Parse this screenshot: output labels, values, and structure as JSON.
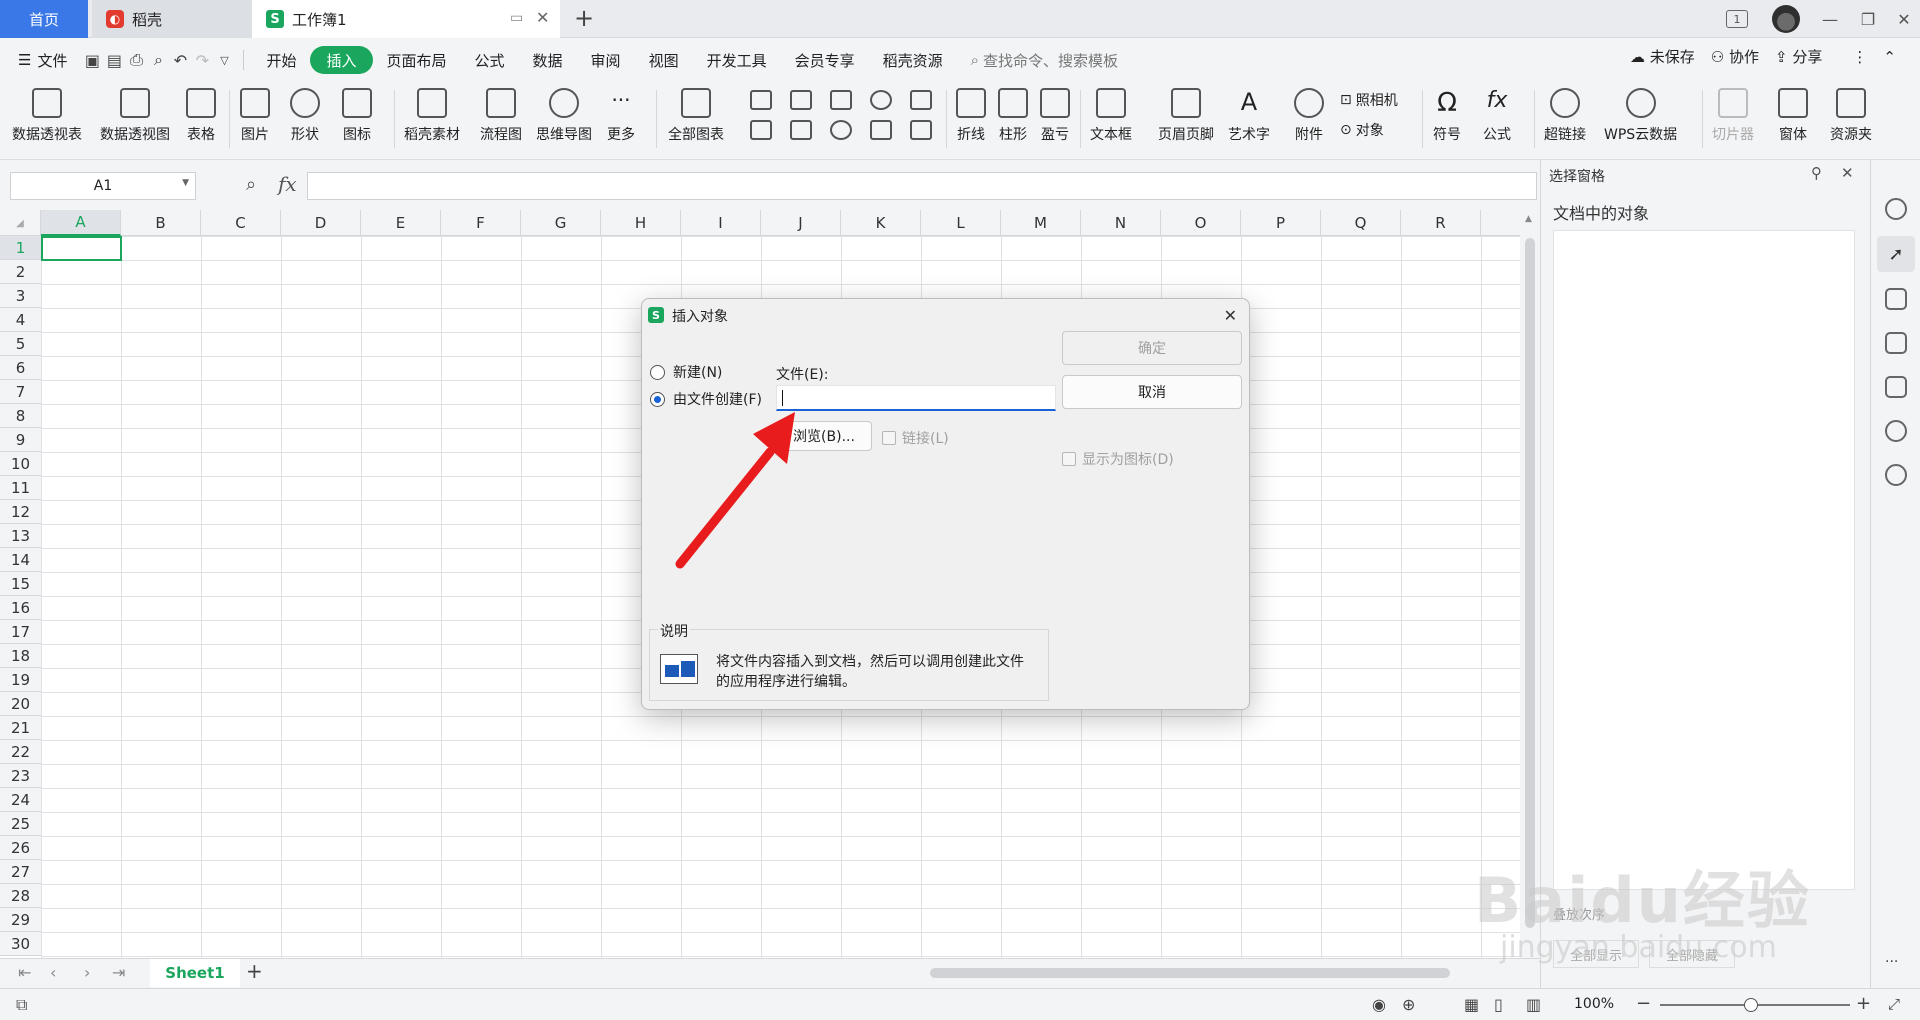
{
  "tabs": {
    "home": "首页",
    "daoke": "稻壳",
    "workbook": "工作簿1",
    "new_tab": "+"
  },
  "window": {
    "badge": "1"
  },
  "menubar": {
    "file": "文件",
    "items": [
      "开始",
      "插入",
      "页面布局",
      "公式",
      "数据",
      "审阅",
      "视图",
      "开发工具",
      "会员专享",
      "稻壳资源"
    ],
    "active": "插入",
    "search": "查找命令、搜索模板",
    "unsaved": "未保存",
    "collab": "协作",
    "share": "分享"
  },
  "ribbon": {
    "pivot_table": "数据透视表",
    "pivot_view": "数据透视图",
    "table": "表格",
    "picture": "图片",
    "shape": "形状",
    "icon": "图标",
    "daoke_material": "稻壳素材",
    "flowchart": "流程图",
    "mindmap": "思维导图",
    "more": "更多",
    "all_charts": "全部图表",
    "line": "折线",
    "column": "柱形",
    "winloss": "盈亏",
    "textbox": "文本框",
    "header_footer": "页眉页脚",
    "wordart": "艺术字",
    "attachment": "附件",
    "camera": "照相机",
    "object": "对象",
    "symbol": "符号",
    "formula": "公式",
    "hyperlink": "超链接",
    "wps_cloud": "WPS云数据",
    "slicer": "切片器",
    "form": "窗体",
    "resources": "资源夹"
  },
  "formula_bar": {
    "cell_ref": "A1",
    "fx": "fx"
  },
  "columns": [
    "A",
    "B",
    "C",
    "D",
    "E",
    "F",
    "G",
    "H",
    "I",
    "J",
    "K",
    "L",
    "M",
    "N",
    "O",
    "P",
    "Q",
    "R"
  ],
  "rows": [
    "1",
    "2",
    "3",
    "4",
    "5",
    "6",
    "7",
    "8",
    "9",
    "10",
    "11",
    "12",
    "13",
    "14",
    "15",
    "16",
    "17",
    "18",
    "19",
    "20",
    "21",
    "22",
    "23",
    "24",
    "25",
    "26",
    "27",
    "28",
    "29",
    "30"
  ],
  "sheets": {
    "active": "Sheet1",
    "add": "+"
  },
  "status": {
    "zoom": "100%"
  },
  "pane": {
    "title": "选择窗格",
    "subtitle": "文档中的对象",
    "btn_show_all": "全部显示",
    "btn_hide_all": "全部隐藏",
    "order_label": "叠放次序"
  },
  "dialog": {
    "title": "插入对象",
    "close": "✕",
    "radio_new": "新建(N)",
    "radio_from_file": "由文件创建(F)",
    "file_label": "文件(E):",
    "file_value": "",
    "browse": "浏览(B)...",
    "link": "链接(L)",
    "ok": "确定",
    "cancel": "取消",
    "display_as_icon": "显示为图标(D)",
    "desc_title": "说明",
    "desc_text_1": "将文件内容插入到文档，然后可以调用创建此文件",
    "desc_text_2": "的应用程序进行编辑。"
  },
  "watermark": {
    "text": "Baidu经验",
    "url": "jingyan.baidu.com"
  },
  "colors": {
    "accent": "#1aa65d",
    "tab_blue": "#3b78e7",
    "arrow_red": "#e81c1c"
  }
}
